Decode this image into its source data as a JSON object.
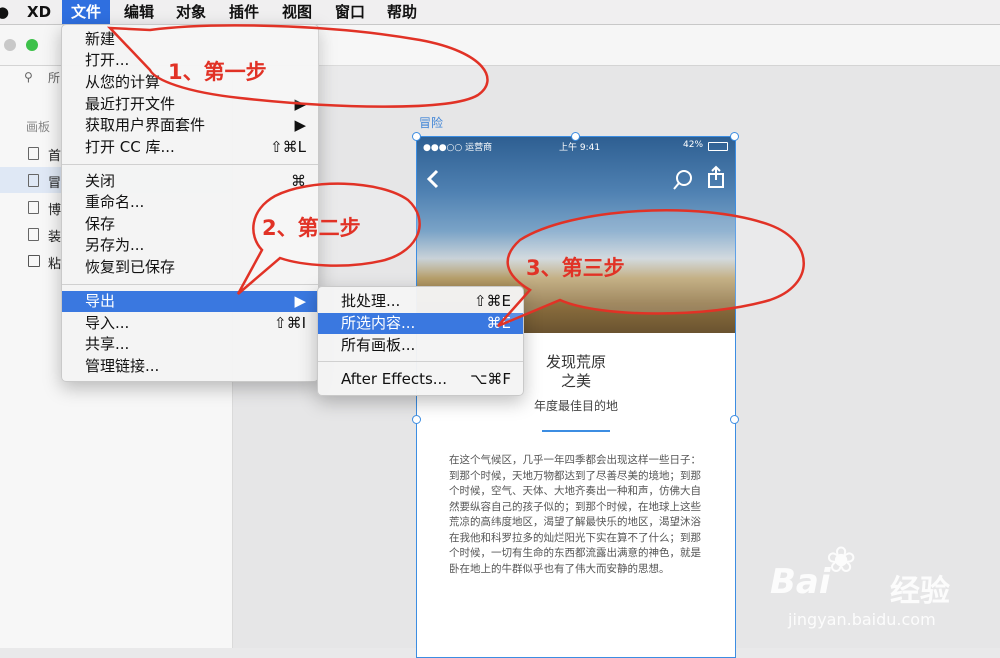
{
  "menubar": {
    "apple": "́",
    "app": "XD",
    "items": [
      "文件",
      "编辑",
      "对象",
      "插件",
      "视图",
      "窗口",
      "帮助"
    ]
  },
  "left_panel": {
    "search_placeholder": "所",
    "title": "画板",
    "artboards": [
      "首",
      "冒",
      "博",
      "装",
      "粘"
    ]
  },
  "file_menu": {
    "items": [
      {
        "label": "新建",
        "shortcut": ""
      },
      {
        "label": "打开...",
        "shortcut": ""
      },
      {
        "label": "从您的计算",
        "shortcut": ""
      },
      {
        "label": "最近打开文件",
        "shortcut": "▶"
      },
      {
        "label": "获取用户界面套件",
        "shortcut": "▶"
      },
      {
        "label": "打开 CC 库...",
        "shortcut": "⇧⌘L"
      },
      {
        "label": "关闭",
        "shortcut": "⌘"
      },
      {
        "label": "重命名...",
        "shortcut": ""
      },
      {
        "label": "保存",
        "shortcut": ""
      },
      {
        "label": "另存为...",
        "shortcut": ""
      },
      {
        "label": "恢复到已保存",
        "shortcut": ""
      },
      {
        "label": "导出",
        "shortcut": "▶"
      },
      {
        "label": "导入...",
        "shortcut": "⇧⌘I"
      },
      {
        "label": "共享...",
        "shortcut": ""
      },
      {
        "label": "管理链接...",
        "shortcut": ""
      }
    ]
  },
  "export_submenu": {
    "items": [
      {
        "label": "批处理...",
        "shortcut": "⇧⌘E"
      },
      {
        "label": "所选内容...",
        "shortcut": "⌘E"
      },
      {
        "label": "所有画板...",
        "shortcut": ""
      },
      {
        "label": "After Effects...",
        "shortcut": "⌥⌘F"
      }
    ]
  },
  "artboard": {
    "name": "冒险",
    "status_left": "●●●○○ 运营商",
    "status_time": "上午 9:41",
    "status_right": "42%",
    "title_line1": "发现荒原",
    "title_line2": "之美",
    "subtitle": "年度最佳目的地",
    "body": "在这个气候区，几乎一年四季都会出现这样一些日子：到那个时候，天地万物都达到了尽善尽美的境地；到那个时候，空气、天体、大地齐奏出一种和声，仿佛大自然要纵容自己的孩子似的；到那个时候，在地球上这些荒凉的高纬度地区，渴望了解最快乐的地区，渴望沐浴在我他和科罗拉多的灿烂阳光下实在算不了什么；到那个时候，一切有生命的东西都流露出满意的神色，就是卧在地上的牛群似乎也有了伟大而安静的思想。"
  },
  "annotations": {
    "step1": "1、第一步",
    "step2": "2、第二步",
    "step3": "3、第三步"
  },
  "watermark": {
    "brand": "Bai",
    "brand2": "经验",
    "url": "jingyan.baidu.com"
  },
  "colors": {
    "accent": "#2f6fe0",
    "highlight": "#3a78e0",
    "artboard_border": "#3c8de2",
    "bubble_red": "#e13226"
  }
}
